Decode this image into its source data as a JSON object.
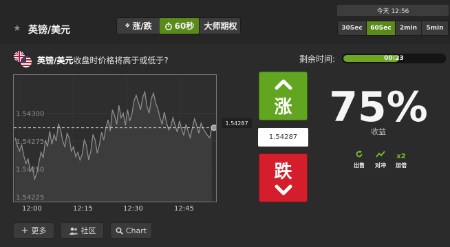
{
  "header": {
    "pair": "英镑/美元",
    "modes": {
      "updown": "涨/跌",
      "sixty": "60秒",
      "master": "大师期权"
    },
    "clock": "今天 12:56",
    "durations": [
      "30Sec",
      "60Sec",
      "2min",
      "5min"
    ],
    "selected_duration": "60Sec"
  },
  "question": {
    "pair": "英镑/美元",
    "text": "收盘时价格将高于或低于?"
  },
  "timer": {
    "label": "剩余时间:",
    "value": "00:23",
    "progress": 0.55
  },
  "trade": {
    "up_label": "涨",
    "down_label": "跌",
    "current_price": "1.54287",
    "payout": "75%",
    "payout_label": "收益",
    "actions": {
      "sell": "出售",
      "hedge": "对冲",
      "double": "加倍"
    }
  },
  "footer": {
    "more": "更多",
    "community": "社区",
    "chart": "Chart"
  },
  "colors": {
    "up": "#62a520",
    "down": "#d51e2b",
    "accent_green": "#5a8a1a",
    "timer_green": "#6fa622"
  },
  "chart_data": {
    "type": "line",
    "y_ticks": [
      "1.54300",
      "1.54275",
      "1.54250",
      "1.54225"
    ],
    "x_ticks": [
      "12:00",
      "12:15",
      "12:30",
      "12:45"
    ],
    "ylim": [
      1.54222,
      1.54333
    ],
    "xlim": [
      0,
      55
    ],
    "strike": 1.54287,
    "series": [
      {
        "x": [
          0,
          0.6,
          1.2,
          1.8,
          2.4,
          3,
          3.6,
          4.2,
          4.8,
          5.4,
          6,
          6.6,
          7.2,
          7.8,
          8.4,
          9,
          9.6,
          10.2,
          10.8,
          11.4,
          12,
          12.6,
          13.2,
          13.8,
          14.4,
          15,
          15.6,
          16.2,
          16.8,
          17.4,
          18,
          18.6,
          19.2,
          19.8,
          20.4,
          21,
          21.6,
          22.2,
          22.8,
          23.4,
          24,
          24.6,
          25.2,
          25.8,
          26.4,
          27,
          27.6,
          28.2,
          28.8,
          29.4,
          30,
          30.6,
          31.2,
          31.8,
          32.4,
          33,
          33.6,
          34.2,
          34.8,
          35.4,
          36,
          36.6,
          37.2,
          37.8,
          38.4,
          39,
          39.6,
          40.2,
          40.8,
          41.4,
          42,
          42.6,
          43.2,
          43.8,
          44.4,
          45,
          45.6,
          46.2,
          46.8,
          47.4,
          48,
          48.6,
          49.2,
          49.8,
          50.4,
          51,
          51.6,
          52.2,
          52.8,
          53.4,
          54,
          54.6
        ],
        "values": [
          1.54278,
          1.54271,
          1.54266,
          1.54272,
          1.54262,
          1.54255,
          1.54259,
          1.54248,
          1.54252,
          1.54241,
          1.54246,
          1.54256,
          1.54265,
          1.5426,
          1.54276,
          1.5427,
          1.54284,
          1.54272,
          1.54281,
          1.54275,
          1.5429,
          1.54286,
          1.54275,
          1.5427,
          1.54282,
          1.54278,
          1.54266,
          1.5427,
          1.54261,
          1.54265,
          1.54258,
          1.54263,
          1.54276,
          1.54271,
          1.54258,
          1.54266,
          1.54281,
          1.54276,
          1.54264,
          1.54272,
          1.54283,
          1.54276,
          1.54287,
          1.54294,
          1.54284,
          1.54303,
          1.54298,
          1.5429,
          1.54307,
          1.54296,
          1.543,
          1.54289,
          1.54303,
          1.54293,
          1.54299,
          1.54311,
          1.54316,
          1.5431,
          1.54303,
          1.54314,
          1.54319,
          1.54306,
          1.543,
          1.54313,
          1.54318,
          1.54309,
          1.54304,
          1.54296,
          1.5429,
          1.54301,
          1.54292,
          1.54285,
          1.54288,
          1.54296,
          1.54289,
          1.54283,
          1.54293,
          1.54286,
          1.5428,
          1.5429,
          1.54284,
          1.54278,
          1.54287,
          1.54295,
          1.54289,
          1.54282,
          1.54291,
          1.54286,
          1.54283,
          1.5428,
          1.54278,
          1.54287
        ]
      }
    ]
  }
}
